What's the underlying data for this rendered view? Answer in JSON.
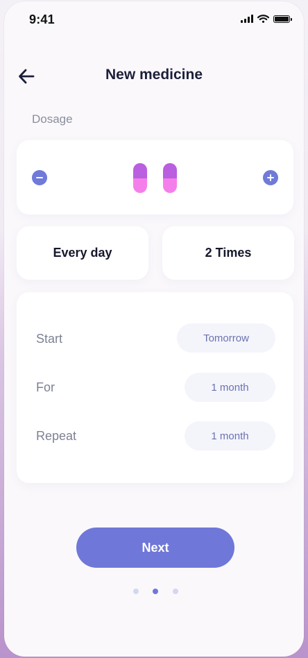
{
  "status_bar": {
    "time": "9:41"
  },
  "header": {
    "title": "New medicine",
    "back_icon": "arrow-left-icon"
  },
  "dosage": {
    "label": "Dosage",
    "pill_count": 2,
    "pill_colors": {
      "top": "#b95fe0",
      "bottom": "#f57fea"
    },
    "decrease_icon": "minus-circle-icon",
    "increase_icon": "plus-circle-icon"
  },
  "frequency": {
    "interval": "Every day",
    "times": "2 Times"
  },
  "schedule": {
    "rows": [
      {
        "label": "Start",
        "value": "Tomorrow"
      },
      {
        "label": "For",
        "value": "1 month"
      },
      {
        "label": "Repeat",
        "value": "1 month"
      }
    ]
  },
  "actions": {
    "next_label": "Next"
  },
  "pagination": {
    "total": 3,
    "current": 2
  },
  "colors": {
    "accent": "#6f78d8",
    "text_dark": "#1c1f3a",
    "muted": "#8a8e9e"
  }
}
